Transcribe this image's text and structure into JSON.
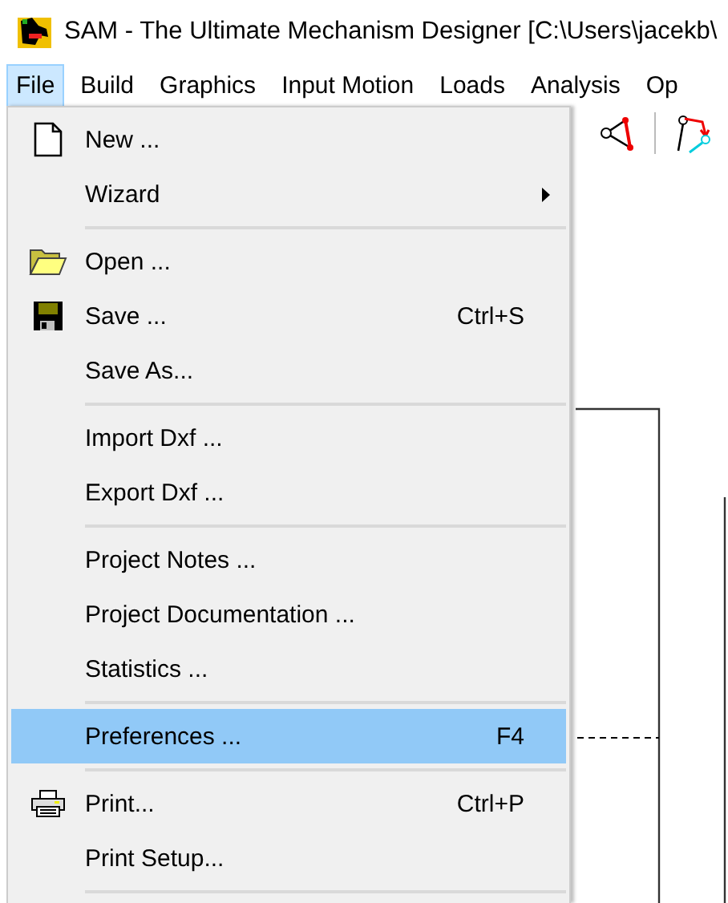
{
  "window": {
    "title": "SAM - The Ultimate Mechanism Designer [C:\\Users\\jacekb\\"
  },
  "menu_bar": [
    {
      "label": "File",
      "selected": true
    },
    {
      "label": "Build",
      "selected": false
    },
    {
      "label": "Graphics",
      "selected": false
    },
    {
      "label": "Input Motion",
      "selected": false
    },
    {
      "label": "Loads",
      "selected": false
    },
    {
      "label": "Analysis",
      "selected": false
    },
    {
      "label": "Op",
      "selected": false
    }
  ],
  "file_menu": {
    "groups": [
      [
        {
          "label": "New ...",
          "kind": "new",
          "submenu": false,
          "selected": false
        },
        {
          "label": "Wizard",
          "kind": "plain",
          "submenu": true,
          "selected": false
        }
      ],
      [
        {
          "label": "Open ...",
          "kind": "open",
          "submenu": false,
          "selected": false
        },
        {
          "label": "Save ...",
          "kind": "save",
          "shortcut": "Ctrl+S",
          "submenu": false,
          "selected": false
        },
        {
          "label": "Save As...",
          "kind": "plain",
          "submenu": false,
          "selected": false
        }
      ],
      [
        {
          "label": "Import Dxf ...",
          "kind": "plain",
          "submenu": false,
          "selected": false
        },
        {
          "label": "Export Dxf ...",
          "kind": "plain",
          "submenu": false,
          "selected": false
        }
      ],
      [
        {
          "label": "Project Notes ...",
          "kind": "plain",
          "submenu": false,
          "selected": false
        },
        {
          "label": "Project Documentation ...",
          "kind": "plain",
          "submenu": false,
          "selected": false
        },
        {
          "label": "Statistics ...",
          "kind": "plain",
          "submenu": false,
          "selected": false
        }
      ],
      [
        {
          "label": "Preferences ...",
          "kind": "plain",
          "shortcut": "F4",
          "submenu": false,
          "selected": true
        }
      ],
      [
        {
          "label": "Print...",
          "kind": "print",
          "shortcut": "Ctrl+P",
          "submenu": false,
          "selected": false
        },
        {
          "label": "Print Setup...",
          "kind": "plain",
          "submenu": false,
          "selected": false
        }
      ]
    ]
  }
}
